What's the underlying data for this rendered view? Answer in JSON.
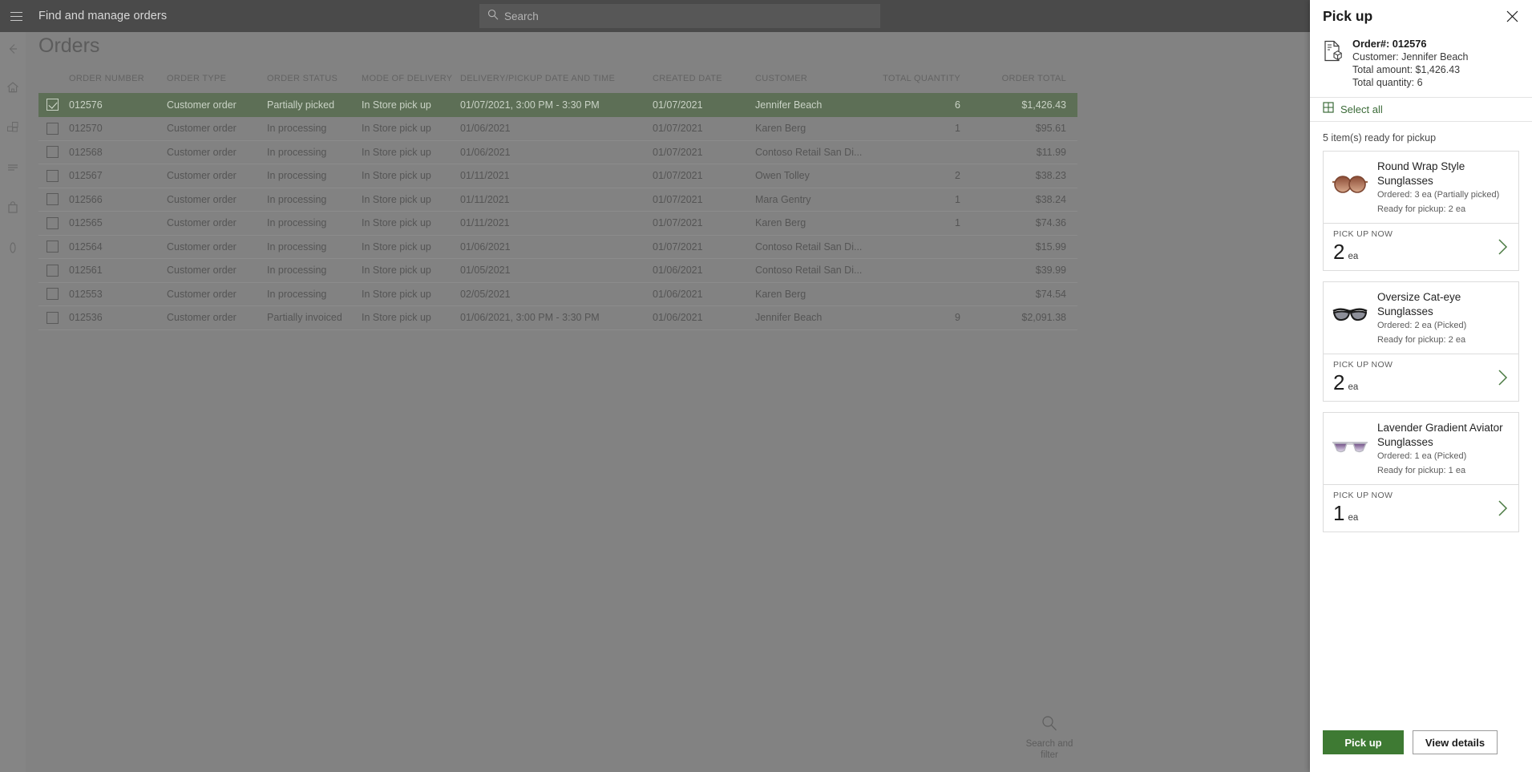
{
  "topbar": {
    "app_title": "Find and manage orders",
    "search_placeholder": "Search",
    "menu_icon": "hamburger-icon",
    "search_icon": "search-icon",
    "icons": [
      "feedback-icon",
      "refresh-icon",
      "settings-icon"
    ]
  },
  "rail": {
    "items": [
      "back-arrow-icon",
      "home-icon",
      "products-icon",
      "list-icon",
      "bag-icon",
      "numpad-icon"
    ]
  },
  "page": {
    "title": "Orders",
    "search_and_filter": "Search and\nfilter",
    "search_filter_line1": "Search and",
    "search_filter_line2": "filter"
  },
  "grid": {
    "columns": [
      "ORDER NUMBER",
      "ORDER TYPE",
      "ORDER STATUS",
      "MODE OF DELIVERY",
      "DELIVERY/PICKUP DATE AND TIME",
      "CREATED DATE",
      "CUSTOMER",
      "TOTAL QUANTITY",
      "ORDER TOTAL"
    ],
    "rows": [
      {
        "selected": true,
        "order_number": "012576",
        "order_type": "Customer order",
        "order_status": "Partially picked",
        "mode": "In Store pick up",
        "datetime": "01/07/2021, 3:00 PM - 3:30 PM",
        "created": "01/07/2021",
        "customer": "Jennifer Beach",
        "qty": "6",
        "total": "$1,426.43"
      },
      {
        "selected": false,
        "order_number": "012570",
        "order_type": "Customer order",
        "order_status": "In processing",
        "mode": "In Store pick up",
        "datetime": "01/06/2021",
        "created": "01/07/2021",
        "customer": "Karen Berg",
        "qty": "1",
        "total": "$95.61"
      },
      {
        "selected": false,
        "order_number": "012568",
        "order_type": "Customer order",
        "order_status": "In processing",
        "mode": "In Store pick up",
        "datetime": "01/06/2021",
        "created": "01/07/2021",
        "customer": "Contoso Retail San Di...",
        "qty": "",
        "total": "$11.99"
      },
      {
        "selected": false,
        "order_number": "012567",
        "order_type": "Customer order",
        "order_status": "In processing",
        "mode": "In Store pick up",
        "datetime": "01/11/2021",
        "created": "01/07/2021",
        "customer": "Owen Tolley",
        "qty": "2",
        "total": "$38.23"
      },
      {
        "selected": false,
        "order_number": "012566",
        "order_type": "Customer order",
        "order_status": "In processing",
        "mode": "In Store pick up",
        "datetime": "01/11/2021",
        "created": "01/07/2021",
        "customer": "Mara Gentry",
        "qty": "1",
        "total": "$38.24"
      },
      {
        "selected": false,
        "order_number": "012565",
        "order_type": "Customer order",
        "order_status": "In processing",
        "mode": "In Store pick up",
        "datetime": "01/11/2021",
        "created": "01/07/2021",
        "customer": "Karen Berg",
        "qty": "1",
        "total": "$74.36"
      },
      {
        "selected": false,
        "order_number": "012564",
        "order_type": "Customer order",
        "order_status": "In processing",
        "mode": "In Store pick up",
        "datetime": "01/06/2021",
        "created": "01/07/2021",
        "customer": "Contoso Retail San Di...",
        "qty": "",
        "total": "$15.99"
      },
      {
        "selected": false,
        "order_number": "012561",
        "order_type": "Customer order",
        "order_status": "In processing",
        "mode": "In Store pick up",
        "datetime": "01/05/2021",
        "created": "01/06/2021",
        "customer": "Contoso Retail San Di...",
        "qty": "",
        "total": "$39.99"
      },
      {
        "selected": false,
        "order_number": "012553",
        "order_type": "Customer order",
        "order_status": "In processing",
        "mode": "In Store pick up",
        "datetime": "02/05/2021",
        "created": "01/06/2021",
        "customer": "Karen Berg",
        "qty": "",
        "total": "$74.54"
      },
      {
        "selected": false,
        "order_number": "012536",
        "order_type": "Customer order",
        "order_status": "Partially invoiced",
        "mode": "In Store pick up",
        "datetime": "01/06/2021, 3:00 PM - 3:30 PM",
        "created": "01/06/2021",
        "customer": "Jennifer Beach",
        "qty": "9",
        "total": "$2,091.38"
      }
    ]
  },
  "panel": {
    "title": "Pick up",
    "close_icon": "close-icon",
    "order_icon": "order-document-icon",
    "order_number_label": "Order#: 012576",
    "customer_label": "Customer: Jennifer Beach",
    "total_amount_label": "Total amount: $1,426.43",
    "total_quantity_label": "Total quantity: 6",
    "select_all_label": "Select all",
    "select_all_icon": "grid-select-icon",
    "ready_line": "5 item(s) ready for pickup",
    "pick_label": "PICK UP NOW",
    "chevron_icon": "chevron-right-icon",
    "items": [
      {
        "name": "Round Wrap Style Sunglasses",
        "ordered": "Ordered: 3 ea (Partially picked)",
        "ready": "Ready for pickup: 2 ea",
        "pick_label": "PICK UP NOW",
        "qty": "2",
        "uom": "ea",
        "thumb": "round-wrap-sunglasses-thumb"
      },
      {
        "name": "Oversize Cat-eye Sunglasses",
        "ordered": "Ordered: 2 ea (Picked)",
        "ready": "Ready for pickup: 2 ea",
        "pick_label": "PICK UP NOW",
        "qty": "2",
        "uom": "ea",
        "thumb": "cat-eye-sunglasses-thumb"
      },
      {
        "name": "Lavender Gradient Aviator Sunglasses",
        "ordered": "Ordered: 1 ea (Picked)",
        "ready": "Ready for pickup: 1 ea",
        "pick_label": "PICK UP NOW",
        "qty": "1",
        "uom": "ea",
        "thumb": "aviator-sunglasses-thumb"
      }
    ],
    "primary_button": "Pick up",
    "secondary_button": "View details"
  },
  "colors": {
    "accent_green": "#3e7a33",
    "selected_row": "#5d6f56",
    "topbar": "#4a4a4a",
    "dim_overlay": "#808080"
  }
}
